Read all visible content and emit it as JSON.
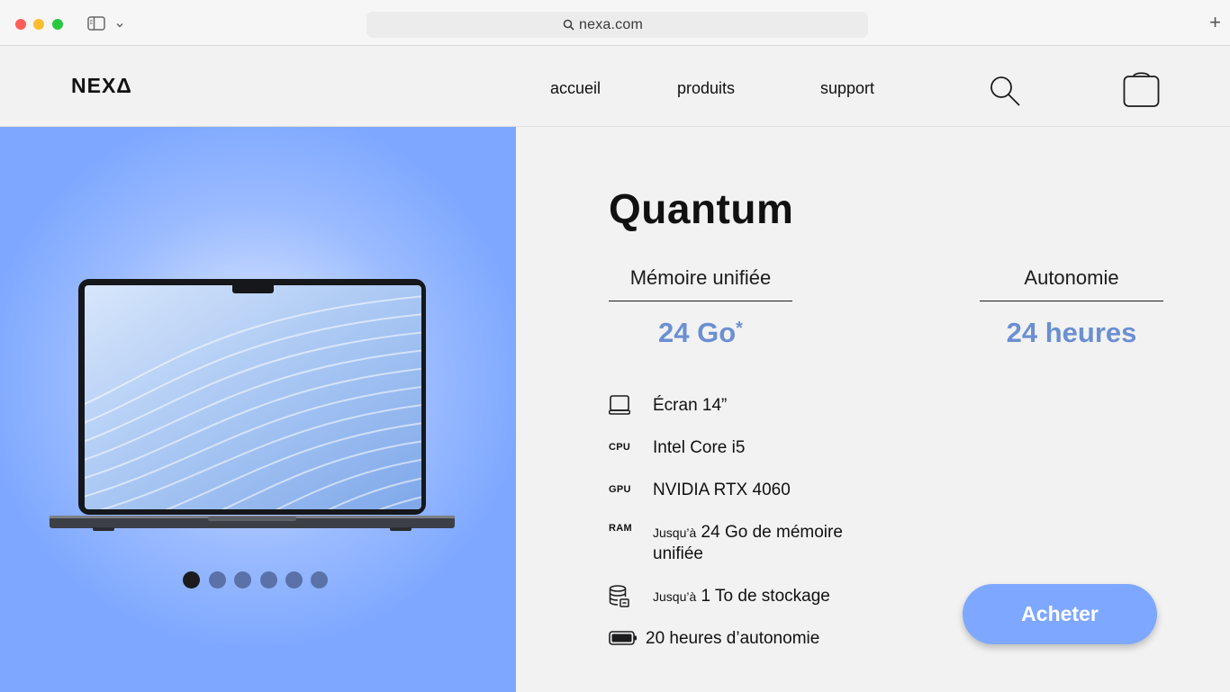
{
  "browser": {
    "url": "nexa.com"
  },
  "header": {
    "logo": "NEXΔ",
    "nav": [
      {
        "label": "accueil"
      },
      {
        "label": "produits"
      },
      {
        "label": "support"
      }
    ]
  },
  "product": {
    "name": "Quantum",
    "specs": [
      {
        "label": "Mémoire unifiée",
        "value": "24 Go",
        "mark": "*"
      },
      {
        "label": "Autonomie",
        "value": "24 heures"
      }
    ],
    "features": [
      {
        "icon": "screen-icon",
        "text": "Écran 14”"
      },
      {
        "icon": "cpu",
        "icon_label": "CPU",
        "text": "Intel Core i5"
      },
      {
        "icon": "gpu",
        "icon_label": "GPU",
        "text": "NVIDIA RTX 4060"
      },
      {
        "icon": "ram",
        "icon_label": "RAM",
        "prefix": "Jusqu’à",
        "text": "24 Go de mémoire",
        "text2": "unifiée"
      },
      {
        "icon": "storage-icon",
        "prefix": "Jusqu’à",
        "text": "1 To de stockage"
      },
      {
        "icon": "battery-icon",
        "text": "20 heures d’autonomie"
      }
    ],
    "buy_label": "Acheter"
  },
  "carousel": {
    "count": 6,
    "active_index": 0
  },
  "colors": {
    "accent": "#7ea8ff",
    "spec_value": "#6b8fd1",
    "dot_inactive": "#5a72a8",
    "dot_active": "#1c1c1e"
  }
}
